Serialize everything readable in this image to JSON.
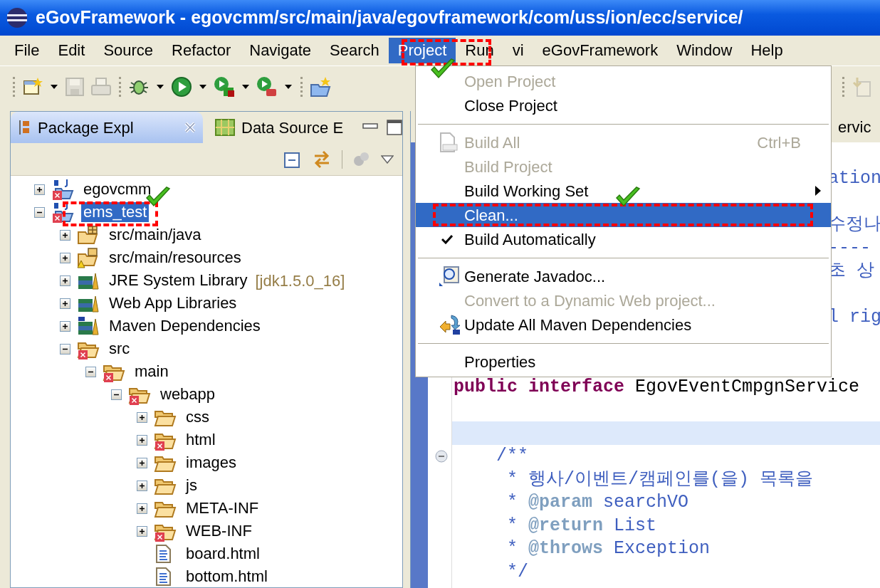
{
  "window": {
    "title": "eGovFramework - egovcmm/src/main/java/egovframework/com/uss/ion/ecc/service/"
  },
  "menu_bar": [
    {
      "label": "File",
      "selected": false
    },
    {
      "label": "Edit",
      "selected": false
    },
    {
      "label": "Source",
      "selected": false
    },
    {
      "label": "Refactor",
      "selected": false
    },
    {
      "label": "Navigate",
      "selected": false
    },
    {
      "label": "Search",
      "selected": false
    },
    {
      "label": "Project",
      "selected": true
    },
    {
      "label": "Run",
      "selected": false
    },
    {
      "label": "vi",
      "selected": false
    },
    {
      "label": "eGovFramework",
      "selected": false
    },
    {
      "label": "Window",
      "selected": false
    },
    {
      "label": "Help",
      "selected": false
    }
  ],
  "toolbar": [
    {
      "kind": "separator"
    },
    {
      "kind": "new",
      "disabled": false,
      "dropdown": true
    },
    {
      "kind": "save",
      "disabled": true,
      "dropdown": false
    },
    {
      "kind": "print",
      "disabled": true,
      "dropdown": false
    },
    {
      "kind": "separator"
    },
    {
      "kind": "debug",
      "disabled": false,
      "dropdown": true
    },
    {
      "kind": "run",
      "disabled": false,
      "dropdown": true
    },
    {
      "kind": "run-config",
      "disabled": false,
      "dropdown": true
    },
    {
      "kind": "run-tool",
      "disabled": false,
      "dropdown": true
    },
    {
      "kind": "separator"
    },
    {
      "kind": "new-project",
      "disabled": false,
      "dropdown": false
    }
  ],
  "toolbar_right": [
    {
      "kind": "import",
      "disabled": true,
      "dropdown": false
    }
  ],
  "left_panel": {
    "tabs": [
      {
        "label": "Package Expl",
        "selected": true
      },
      {
        "label": "Data Source E",
        "selected": false
      }
    ],
    "tree": [
      {
        "label": "egovcmm",
        "kind": "project",
        "error": true,
        "expanded": false,
        "selected": false
      },
      {
        "label": "ems_test",
        "kind": "project",
        "error": true,
        "expanded": true,
        "selected": true,
        "children": [
          {
            "label": "src/main/java",
            "kind": "source-folder",
            "error": false,
            "expanded": false,
            "selected": false
          },
          {
            "label": "src/main/resources",
            "kind": "resource-folder",
            "error": false,
            "expanded": false,
            "selected": false
          },
          {
            "label": "JRE System Library",
            "decoration": "[jdk1.5.0_16]",
            "kind": "library",
            "error": false,
            "expanded": false,
            "selected": false
          },
          {
            "label": "Web App Libraries",
            "kind": "library",
            "error": false,
            "expanded": false,
            "selected": false
          },
          {
            "label": "Maven Dependencies",
            "kind": "maven-library",
            "error": false,
            "expanded": false,
            "selected": false
          },
          {
            "label": "src",
            "kind": "folder",
            "error": true,
            "expanded": true,
            "selected": false,
            "children": [
              {
                "label": "main",
                "kind": "folder",
                "error": true,
                "expanded": true,
                "selected": false,
                "children": [
                  {
                    "label": "webapp",
                    "kind": "folder",
                    "error": true,
                    "expanded": true,
                    "selected": false,
                    "children": [
                      {
                        "label": "css",
                        "kind": "folder",
                        "error": false,
                        "expanded": false,
                        "selected": false
                      },
                      {
                        "label": "html",
                        "kind": "folder",
                        "error": true,
                        "expanded": false,
                        "selected": false
                      },
                      {
                        "label": "images",
                        "kind": "folder",
                        "error": false,
                        "expanded": false,
                        "selected": false
                      },
                      {
                        "label": "js",
                        "kind": "folder",
                        "error": false,
                        "expanded": false,
                        "selected": false
                      },
                      {
                        "label": "META-INF",
                        "kind": "folder",
                        "error": false,
                        "expanded": false,
                        "selected": false
                      },
                      {
                        "label": "WEB-INF",
                        "kind": "folder",
                        "error": true,
                        "expanded": false,
                        "selected": false
                      },
                      {
                        "label": "board.html",
                        "kind": "file",
                        "error": false,
                        "selected": false
                      },
                      {
                        "label": "bottom.html",
                        "kind": "file",
                        "error": false,
                        "selected": false
                      }
                    ]
                  }
                ]
              }
            ]
          }
        ]
      }
    ]
  },
  "menu": {
    "items": [
      {
        "kind": "item",
        "label": "Open Project",
        "disabled": true,
        "selected": false,
        "checked": false,
        "submenu": false
      },
      {
        "kind": "item",
        "label": "Close Project",
        "disabled": false,
        "selected": false,
        "checked": false,
        "submenu": false
      },
      {
        "kind": "separator"
      },
      {
        "kind": "binary",
        "label": "Build All",
        "shortcut": "Ctrl+B",
        "disabled": true,
        "selected": false,
        "checked": false,
        "submenu": false
      },
      {
        "kind": "item",
        "label": "Build Project",
        "disabled": true,
        "selected": false,
        "checked": false,
        "submenu": false
      },
      {
        "kind": "item",
        "label": "Build Working Set",
        "disabled": false,
        "selected": false,
        "checked": false,
        "submenu": true
      },
      {
        "kind": "item",
        "label": "Clean...",
        "disabled": false,
        "selected": true,
        "checked": false,
        "submenu": false
      },
      {
        "kind": "item",
        "label": "Build Automatically",
        "disabled": false,
        "selected": false,
        "checked": true,
        "submenu": false
      },
      {
        "kind": "separator"
      },
      {
        "kind": "javadoc",
        "label": "Generate Javadoc...",
        "disabled": false,
        "selected": false,
        "checked": false,
        "submenu": false
      },
      {
        "kind": "item",
        "label": "Convert to a Dynamic Web project...",
        "disabled": true,
        "selected": false,
        "checked": false,
        "submenu": false
      },
      {
        "kind": "maven",
        "label": "Update All Maven Dependencies",
        "disabled": false,
        "selected": false,
        "checked": false,
        "submenu": false
      },
      {
        "kind": "separator"
      },
      {
        "kind": "item",
        "label": "Properties",
        "disabled": false,
        "selected": false,
        "checked": false,
        "submenu": false
      }
    ]
  },
  "editor": {
    "tab_label": "ervic",
    "lines": [
      {
        "kind": "blank"
      },
      {
        "kind": "partial",
        "text": "ation"
      },
      {
        "kind": "blank"
      },
      {
        "kind": "partial",
        "text": "수정나"
      },
      {
        "kind": "partial",
        "text": "----"
      },
      {
        "kind": "partial",
        "text": "초 상"
      },
      {
        "kind": "blank"
      },
      {
        "kind": "partial",
        "text": "l rig"
      },
      {
        "kind": "blank"
      },
      {
        "kind": "blank"
      },
      {
        "kind": "declaration",
        "keyword": "public interface",
        "name": "EgovEventCmpgnService"
      },
      {
        "kind": "blank"
      },
      {
        "kind": "current"
      },
      {
        "kind": "fold",
        "text": "    /**"
      },
      {
        "kind": "comment",
        "text": "     * 행사/이벤트/캠페인를(을) 목록을"
      },
      {
        "kind": "doc-tag",
        "prefix": "     *",
        "tag": "@param",
        "value": "searchVO"
      },
      {
        "kind": "doc-tag",
        "prefix": "     *",
        "tag": "@return",
        "value": "List"
      },
      {
        "kind": "doc-tag",
        "prefix": "     *",
        "tag": "@throws",
        "value": "Exception"
      },
      {
        "kind": "comment",
        "text": "     */"
      }
    ]
  }
}
